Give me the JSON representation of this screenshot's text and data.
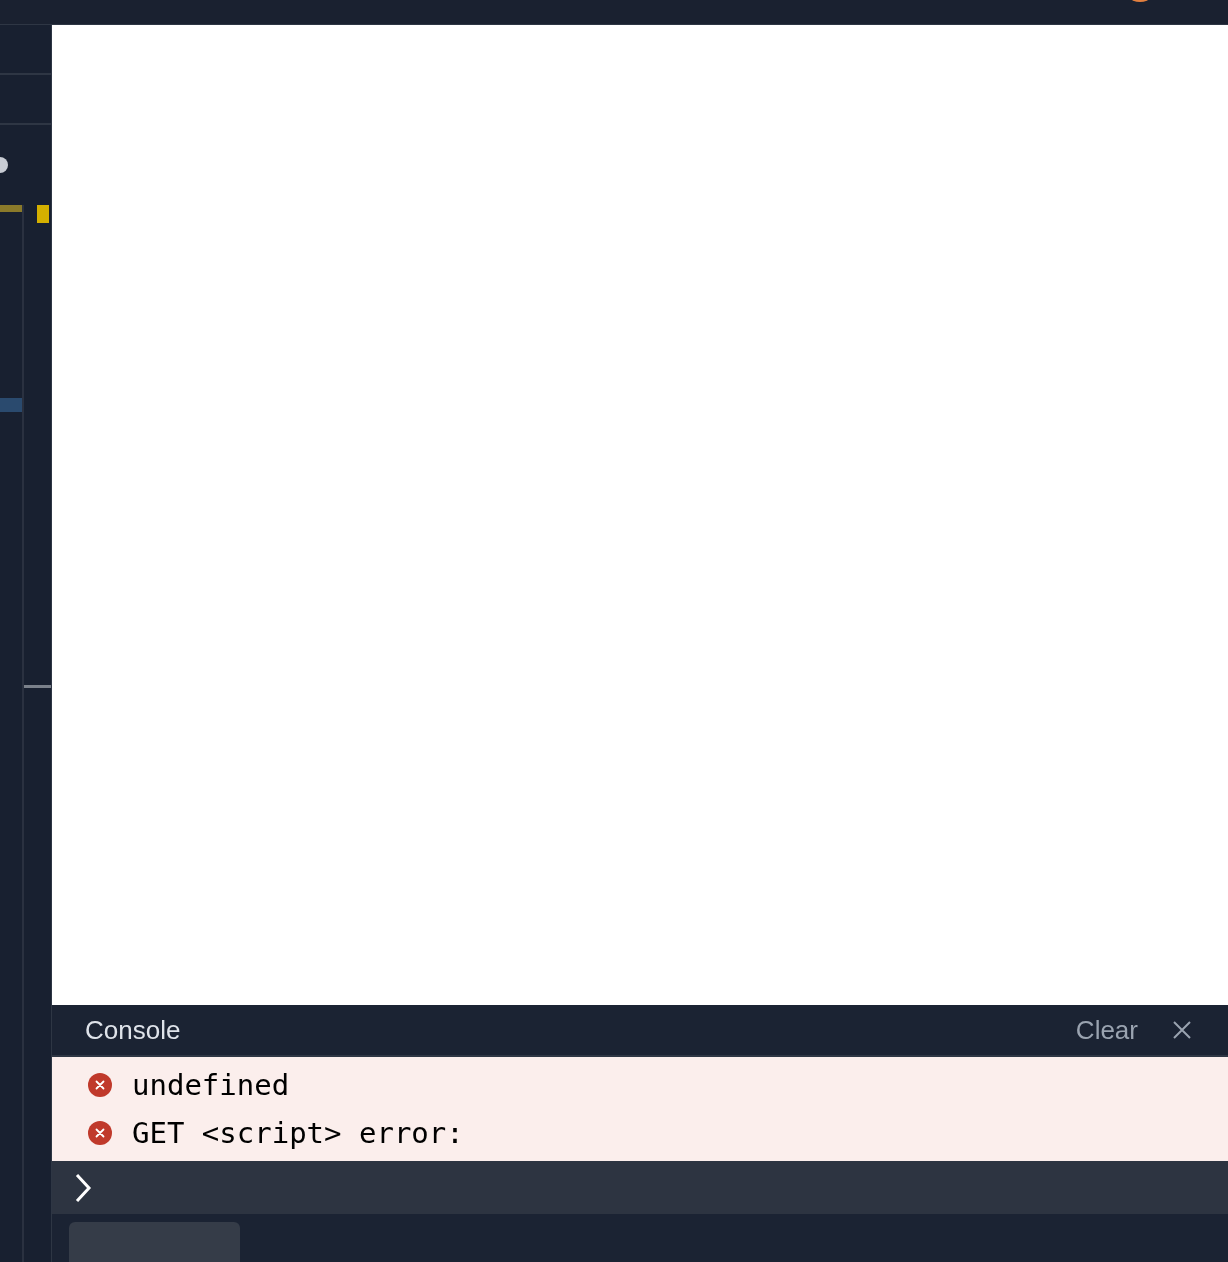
{
  "console": {
    "title": "Console",
    "clear_label": "Clear",
    "messages": [
      {
        "kind": "error",
        "text": "undefined"
      },
      {
        "kind": "error",
        "text": "GET <script> error:"
      }
    ]
  }
}
